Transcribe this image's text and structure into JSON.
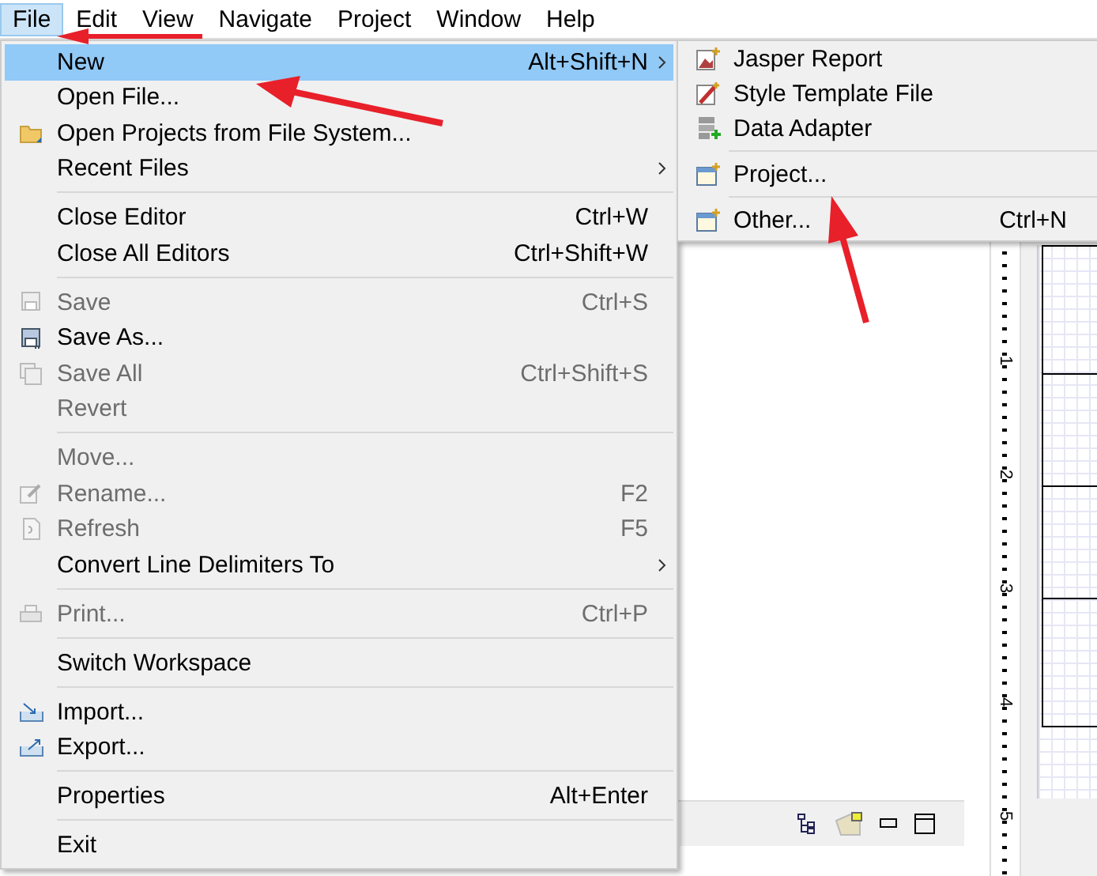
{
  "menubar": [
    {
      "label": "File",
      "selected": true
    },
    {
      "label": "Edit",
      "selected": false
    },
    {
      "label": "View",
      "selected": false
    },
    {
      "label": "Navigate",
      "selected": false
    },
    {
      "label": "Project",
      "selected": false
    },
    {
      "label": "Window",
      "selected": false
    },
    {
      "label": "Help",
      "selected": false
    }
  ],
  "file_menu": [
    {
      "kind": "item",
      "label": "New",
      "shortcut": "Alt+Shift+N",
      "submenu": true,
      "selected": true,
      "disabled": false
    },
    {
      "kind": "item",
      "label": "Open File...",
      "submenu": false,
      "selected": false,
      "disabled": false
    },
    {
      "kind": "item",
      "label": "Open Projects from File System...",
      "submenu": false,
      "selected": false,
      "disabled": false
    },
    {
      "kind": "item",
      "label": "Recent Files",
      "submenu": true,
      "selected": false,
      "disabled": false
    },
    {
      "kind": "separator"
    },
    {
      "kind": "item",
      "label": "Close Editor",
      "shortcut": "Ctrl+W",
      "submenu": false,
      "selected": false,
      "disabled": false
    },
    {
      "kind": "item",
      "label": "Close All Editors",
      "shortcut": "Ctrl+Shift+W",
      "submenu": false,
      "selected": false,
      "disabled": false
    },
    {
      "kind": "separator"
    },
    {
      "kind": "item",
      "label": "Save",
      "shortcut": "Ctrl+S",
      "submenu": false,
      "selected": false,
      "disabled": true
    },
    {
      "kind": "item",
      "label": "Save As...",
      "submenu": false,
      "selected": false,
      "disabled": false
    },
    {
      "kind": "item",
      "label": "Save All",
      "shortcut": "Ctrl+Shift+S",
      "submenu": false,
      "selected": false,
      "disabled": true
    },
    {
      "kind": "item",
      "label": "Revert",
      "submenu": false,
      "selected": false,
      "disabled": true
    },
    {
      "kind": "separator"
    },
    {
      "kind": "item",
      "label": "Move...",
      "submenu": false,
      "selected": false,
      "disabled": true
    },
    {
      "kind": "item",
      "label": "Rename...",
      "shortcut": "F2",
      "submenu": false,
      "selected": false,
      "disabled": true
    },
    {
      "kind": "item",
      "label": "Refresh",
      "shortcut": "F5",
      "submenu": false,
      "selected": false,
      "disabled": true
    },
    {
      "kind": "item",
      "label": "Convert Line Delimiters To",
      "submenu": true,
      "selected": false,
      "disabled": false
    },
    {
      "kind": "separator"
    },
    {
      "kind": "item",
      "label": "Print...",
      "shortcut": "Ctrl+P",
      "submenu": false,
      "selected": false,
      "disabled": true
    },
    {
      "kind": "separator"
    },
    {
      "kind": "item",
      "label": "Switch Workspace",
      "submenu": false,
      "selected": false,
      "disabled": false
    },
    {
      "kind": "separator"
    },
    {
      "kind": "item",
      "label": "Import...",
      "submenu": false,
      "selected": false,
      "disabled": false
    },
    {
      "kind": "item",
      "label": "Export...",
      "submenu": false,
      "selected": false,
      "disabled": false
    },
    {
      "kind": "separator"
    },
    {
      "kind": "item",
      "label": "Properties",
      "shortcut": "Alt+Enter",
      "submenu": false,
      "selected": false,
      "disabled": false
    },
    {
      "kind": "separator"
    },
    {
      "kind": "item",
      "label": "Exit",
      "submenu": false,
      "selected": false,
      "disabled": false
    }
  ],
  "new_submenu": [
    {
      "kind": "item",
      "label": "Jasper Report"
    },
    {
      "kind": "item",
      "label": "Style Template File"
    },
    {
      "kind": "item",
      "label": "Data Adapter"
    },
    {
      "kind": "separator"
    },
    {
      "kind": "item",
      "label": "Project..."
    },
    {
      "kind": "separator"
    },
    {
      "kind": "item",
      "label": "Other...",
      "shortcut": "Ctrl+N"
    }
  ],
  "ruler": {
    "labels": [
      "1",
      "2",
      "3",
      "4",
      "5"
    ]
  }
}
